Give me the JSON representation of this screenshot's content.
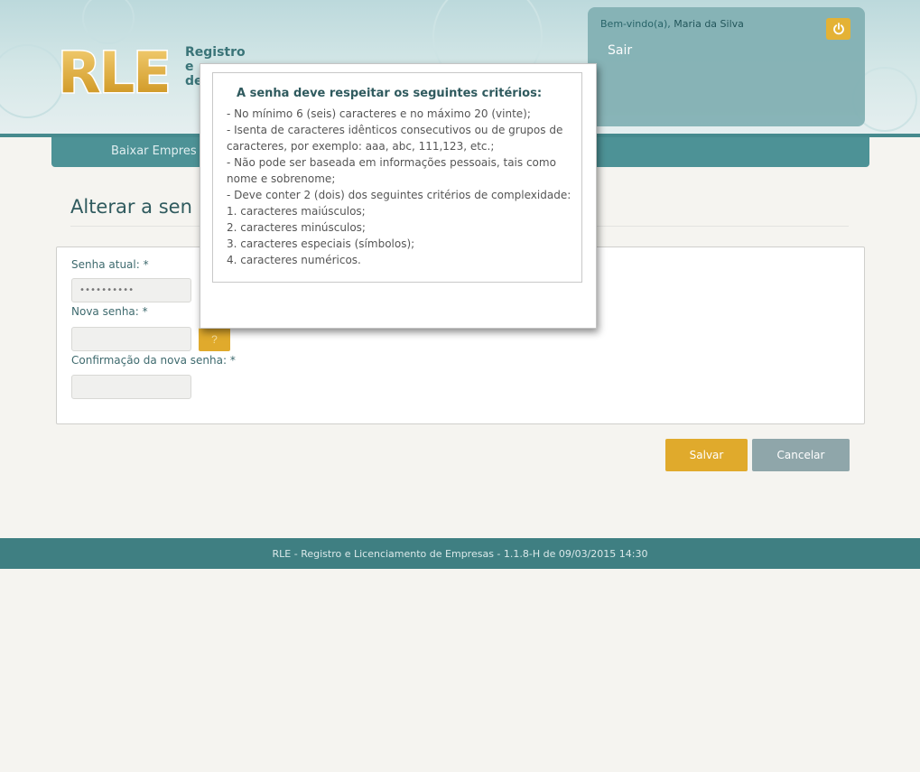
{
  "header": {
    "logo_text": "RLE",
    "brand_lines": [
      "Registro",
      "e",
      "de"
    ],
    "welcome_prefix": "Bem-vindo(a), ",
    "user_name": "Maria da Silva",
    "logout_label": "Sair",
    "power_icon": "power-icon"
  },
  "nav": {
    "items": [
      {
        "label": "Baixar Empres"
      }
    ]
  },
  "page": {
    "title": "Alterar a sen"
  },
  "form": {
    "current_password_label": "Senha atual: *",
    "current_password_value": "••••••••••",
    "new_password_label": "Nova senha: *",
    "new_password_value": "",
    "help_label": "?",
    "confirm_password_label": "Confirmação da nova senha: *",
    "confirm_password_value": ""
  },
  "actions": {
    "save_label": "Salvar",
    "cancel_label": "Cancelar"
  },
  "footer": {
    "text": "RLE - Registro e Licenciamento de Empresas - 1.1.8-H de 09/03/2015 14:30"
  },
  "modal": {
    "title": "A senha deve respeitar os seguintes critérios:",
    "criteria": [
      "- No mínimo 6 (seis) caracteres e no máximo 20 (vinte);",
      "- Isenta de caracteres idênticos consecutivos ou de grupos de caracteres, por exemplo: aaa, abc, 111,123, etc.;",
      "- Não pode ser baseada em informações pessoais, tais como nome e sobrenome;",
      "- Deve conter 2 (dois) dos seguintes critérios de complexidade:",
      "1. caracteres maiúsculos;",
      "2. caracteres minúsculos;",
      "3. caracteres especiais (símbolos);",
      "4. caracteres numéricos."
    ]
  },
  "colors": {
    "accent": "#e0aa2c",
    "teal": "#4d9296",
    "footer": "#3f7f82",
    "cancel": "#8fa6aa"
  }
}
